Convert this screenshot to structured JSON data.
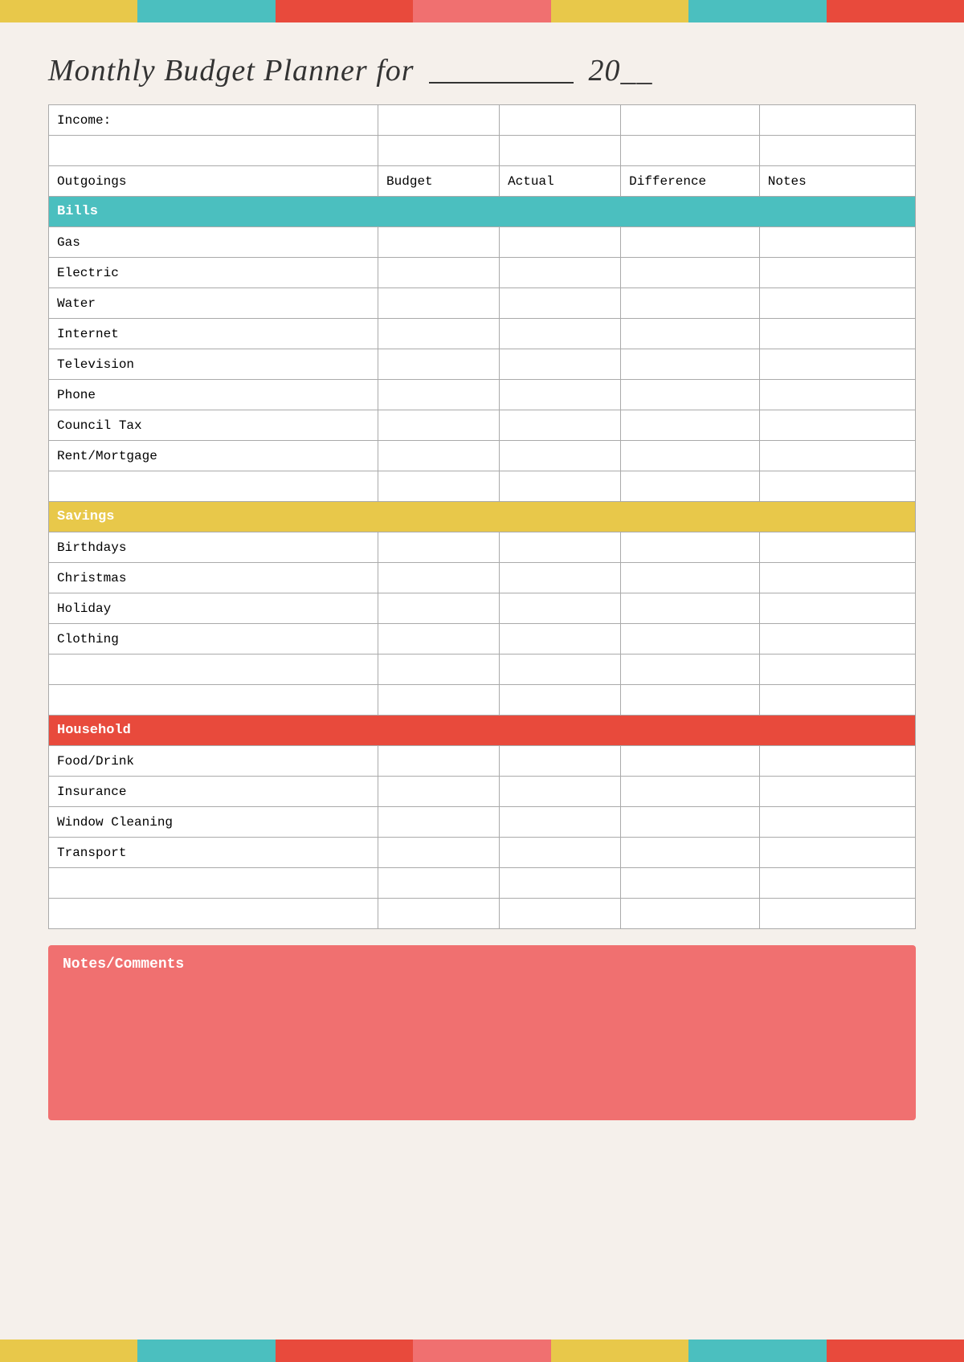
{
  "header": {
    "title_start": "Monthly Budget Planner for",
    "title_blank": "___________",
    "title_year_prefix": "20",
    "title_year_blank": "__"
  },
  "top_bar_segments": [
    {
      "color": "seg-yellow"
    },
    {
      "color": "seg-teal"
    },
    {
      "color": "seg-red"
    },
    {
      "color": "seg-pink"
    },
    {
      "color": "seg-yellow2"
    },
    {
      "color": "seg-teal2"
    },
    {
      "color": "seg-red2"
    }
  ],
  "table": {
    "income_label": "Income:",
    "columns": {
      "outgoings": "Outgoings",
      "budget": "Budget",
      "actual": "Actual",
      "difference": "Difference",
      "notes": "Notes"
    },
    "sections": [
      {
        "name": "Bills",
        "header_class": "bills-header",
        "items": [
          "Gas",
          "Electric",
          "Water",
          "Internet",
          "Television",
          "Phone",
          "Council Tax",
          "Rent/Mortgage"
        ]
      },
      {
        "name": "Savings",
        "header_class": "savings-header",
        "items": [
          "Birthdays",
          "Christmas",
          "Holiday",
          "Clothing",
          "",
          ""
        ]
      },
      {
        "name": "Household",
        "header_class": "household-header",
        "items": [
          "Food/Drink",
          "Insurance",
          "Window Cleaning",
          "Transport",
          "",
          ""
        ]
      }
    ]
  },
  "notes": {
    "label": "Notes/Comments"
  }
}
